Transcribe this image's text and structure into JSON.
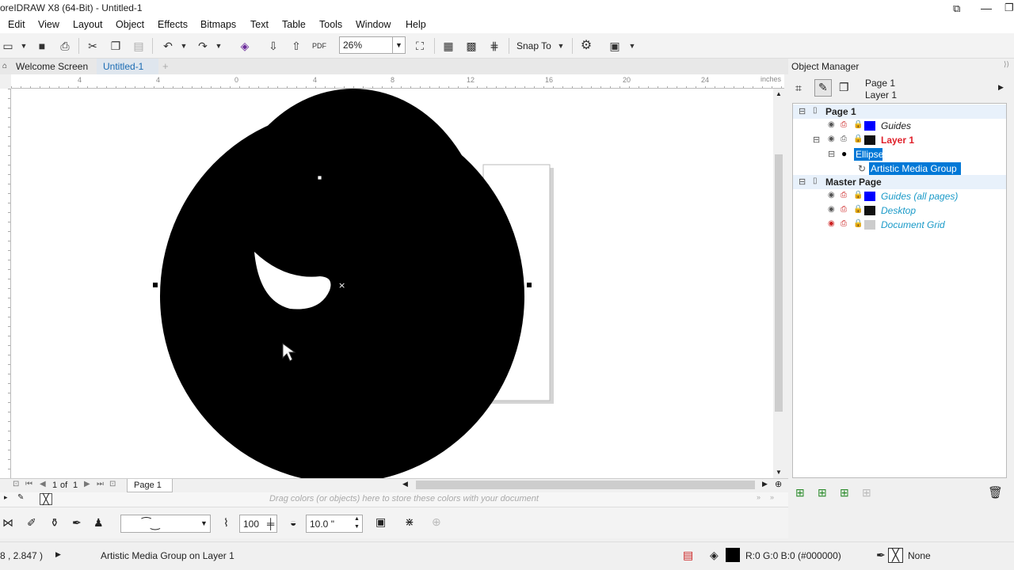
{
  "window": {
    "title": "oreIDRAW X8 (64-Bit) - Untitled-1"
  },
  "menu": [
    "Edit",
    "View",
    "Layout",
    "Object",
    "Effects",
    "Bitmaps",
    "Text",
    "Table",
    "Tools",
    "Window",
    "Help"
  ],
  "toolbar": {
    "zoom": "26%",
    "snap_label": "Snap To"
  },
  "tabs": {
    "welcome": "Welcome Screen",
    "doc": "Untitled-1"
  },
  "ruler": {
    "h_ticks": [
      "4",
      "0",
      "4",
      "8",
      "12",
      "16",
      "20",
      "24"
    ],
    "unit": "inches"
  },
  "pagebar": {
    "page_of": "1",
    "of_label": "of",
    "page_total": "1",
    "page_tab": "Page 1"
  },
  "palette": {
    "hint": "Drag colors (or objects) here to store these colors with your document"
  },
  "propbar": {
    "width_value": "100",
    "size_value": "10.0 \""
  },
  "status": {
    "coords": "8 , 2.847 )",
    "info": "Artistic Media Group on Layer 1",
    "fill": "R:0 G:0 B:0 (#000000)",
    "outline": "None"
  },
  "object_manager": {
    "title": "Object Manager",
    "current_page": "Page 1",
    "current_layer": "Layer 1",
    "tree": {
      "page1": "Page 1",
      "guides": "Guides",
      "layer1": "Layer 1",
      "ellipse": "Ellipse",
      "media_group": "Artistic Media Group",
      "master": "Master Page",
      "guides_all": "Guides (all pages)",
      "desktop": "Desktop",
      "grid": "Document Grid"
    },
    "colors": {
      "blue": "#0000ff",
      "black": "#111111",
      "grey": "#cccccc",
      "red": "#e0202a",
      "cyan": "#1a9ac8",
      "select": "#0078d7"
    }
  }
}
